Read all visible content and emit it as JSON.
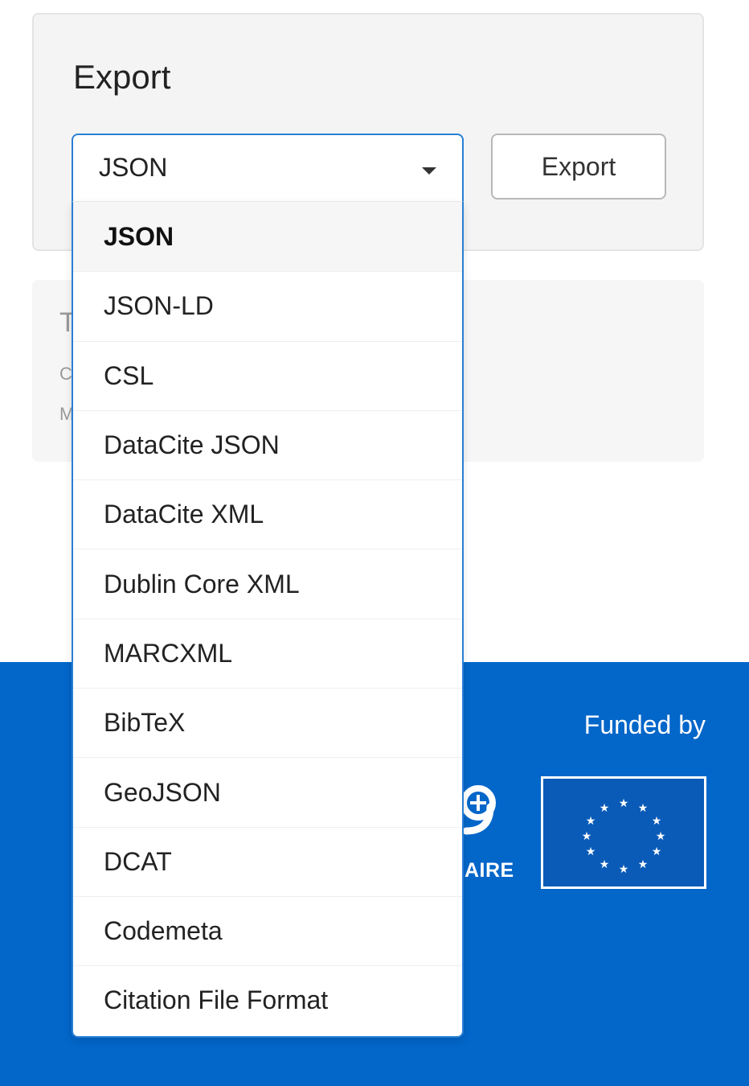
{
  "export": {
    "title": "Export",
    "selected_format": "JSON",
    "button_label": "Export",
    "formats": [
      "JSON",
      "JSON-LD",
      "CSL",
      "DataCite JSON",
      "DataCite XML",
      "Dublin Core XML",
      "MARCXML",
      "BibTeX",
      "GeoJSON",
      "DCAT",
      "Codemeta",
      "Citation File Format"
    ]
  },
  "second_card": {
    "fragments": [
      "T",
      "C",
      "M"
    ]
  },
  "footer": {
    "funded_by_label": "Funded by",
    "partner_logo_text": "AIRE"
  },
  "colors": {
    "accent": "#2a7fd4",
    "footer_bg": "#0366c9",
    "card_bg": "#f4f4f4"
  }
}
